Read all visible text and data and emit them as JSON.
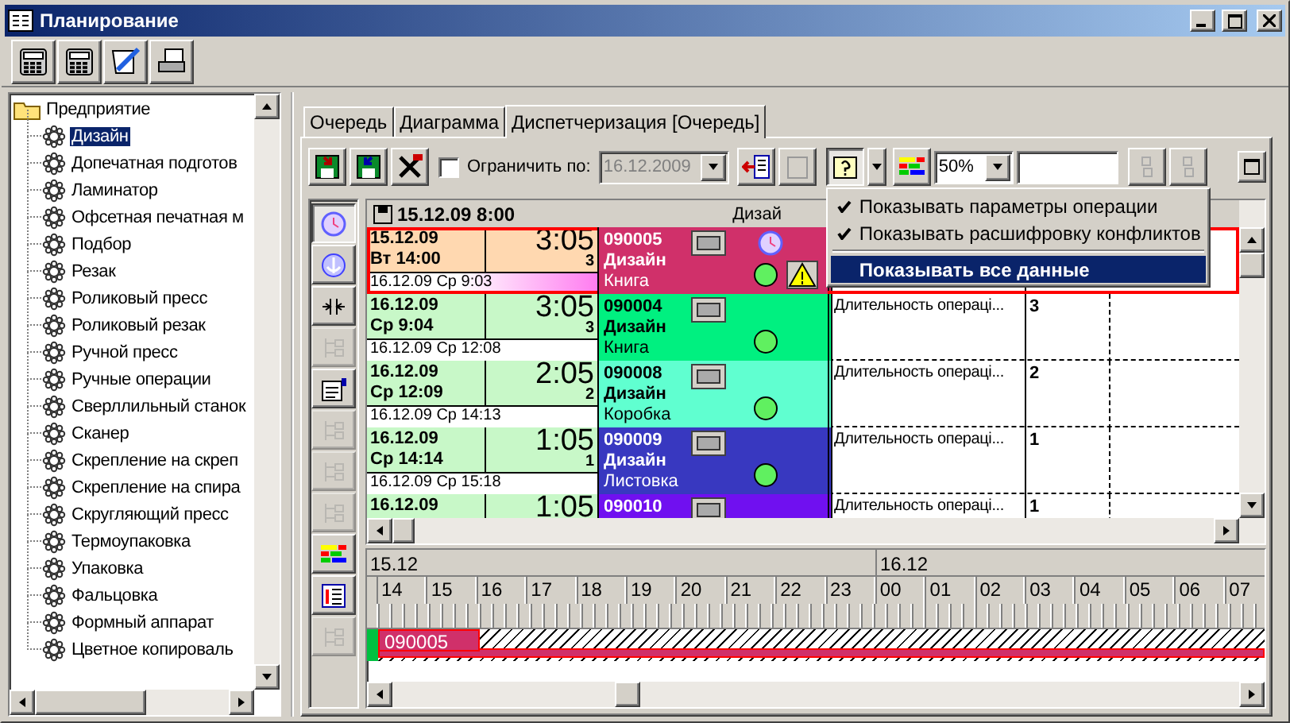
{
  "window": {
    "title": "Планирование"
  },
  "tree": {
    "label": "Предприятие",
    "children": [
      {
        "label": "Дизайн",
        "selected": true
      },
      {
        "label": "Допечатная подготов",
        "selected": false
      },
      {
        "label": "Ламинатор",
        "selected": false
      },
      {
        "label": "Офсетная печатная м",
        "selected": false
      },
      {
        "label": "Подбор",
        "selected": false
      },
      {
        "label": "Резак",
        "selected": false
      },
      {
        "label": "Роликовый пресс",
        "selected": false
      },
      {
        "label": "Роликовый резак",
        "selected": false
      },
      {
        "label": "Ручной пресс",
        "selected": false
      },
      {
        "label": "Ручные операции",
        "selected": false
      },
      {
        "label": "Сверллильный станок",
        "selected": false
      },
      {
        "label": "Сканер",
        "selected": false
      },
      {
        "label": "Скрепление на скреп",
        "selected": false
      },
      {
        "label": "Скрепление на спира",
        "selected": false
      },
      {
        "label": "Скругляющий пресс",
        "selected": false
      },
      {
        "label": "Термоупаковка",
        "selected": false
      },
      {
        "label": "Упаковка",
        "selected": false
      },
      {
        "label": "Фальцовка",
        "selected": false
      },
      {
        "label": "Формный аппарат",
        "selected": false
      },
      {
        "label": "Цветное копироваль",
        "selected": false
      }
    ]
  },
  "tabs": [
    {
      "label": "Очередь",
      "selected": false
    },
    {
      "label": "Диаграмма",
      "selected": false
    },
    {
      "label": "Диспетчеризация [Очередь]",
      "selected": true
    }
  ],
  "toolbar": {
    "limit_checkbox": {
      "label": "Ограничить по:",
      "checked": false
    },
    "limit_date": {
      "value": "16.12.2009",
      "disabled": true
    },
    "help_pressed": true,
    "zoom": {
      "value": "50%"
    }
  },
  "help_menu": {
    "open": true,
    "items": [
      {
        "kind": "check",
        "label": "Показывать параметры операции",
        "checked": true,
        "selected": false
      },
      {
        "kind": "check",
        "label": "Показывать расшифровку конфликтов",
        "checked": true,
        "selected": false
      },
      {
        "kind": "separator"
      },
      {
        "kind": "command",
        "label": "Показывать все данные",
        "selected": true
      }
    ]
  },
  "side_tools": [
    {
      "pressed": true,
      "disabled": false
    },
    {
      "pressed": false,
      "disabled": false
    },
    {
      "pressed": false,
      "disabled": false
    },
    {
      "pressed": false,
      "disabled": true
    },
    {
      "pressed": false,
      "disabled": false
    },
    {
      "pressed": false,
      "disabled": true
    },
    {
      "pressed": false,
      "disabled": true
    },
    {
      "pressed": false,
      "disabled": true
    },
    {
      "pressed": false,
      "disabled": false
    },
    {
      "pressed": false,
      "disabled": false
    },
    {
      "pressed": false,
      "disabled": true
    }
  ],
  "grid": {
    "header": {
      "start": "15.12.09 8:00",
      "column_2": "Дизай"
    },
    "rows": [
      {
        "start_date": "15.12.09",
        "start_time": "Вт 14:00",
        "duration": "3:05",
        "count": "3",
        "end": "16.12.09 Ср 9:03",
        "code": "090005",
        "operation": "Дизайн",
        "product": "Книга",
        "color": "#d0306a",
        "conflict": true,
        "clock": true
      },
      {
        "start_date": "16.12.09",
        "start_time": "Ср 9:04",
        "duration": "3:05",
        "count": "3",
        "end": "16.12.09 Ср 12:08",
        "code": "090004",
        "operation": "Дизайн",
        "product": "Книга",
        "color": "#00f080",
        "conflict": false,
        "clock": false,
        "parameter": "Длительность операці...",
        "value": "3"
      },
      {
        "start_date": "16.12.09",
        "start_time": "Ср 12:09",
        "duration": "2:05",
        "count": "2",
        "end": "16.12.09 Ср 14:13",
        "code": "090008",
        "operation": "Дизайн",
        "product": "Коробка",
        "color": "#60ffd0",
        "conflict": false,
        "clock": false,
        "parameter": "Длительность операці...",
        "value": "2"
      },
      {
        "start_date": "16.12.09",
        "start_time": "Ср 14:14",
        "duration": "1:05",
        "count": "1",
        "end": "16.12.09 Ср 15:18",
        "code": "090009",
        "operation": "Дизайн",
        "product": "Листовка",
        "color": "#3838c0",
        "conflict": false,
        "clock": false,
        "parameter": "Длительность операці...",
        "value": "1"
      },
      {
        "start_date": "16.12.09",
        "duration": "1:05",
        "code": "090010",
        "color": "#7010f0",
        "conflict": false,
        "clock": false,
        "parameter": "Длительность операці...",
        "value": "1"
      }
    ]
  },
  "timeline": {
    "days": [
      "15.12",
      "16.12"
    ],
    "hours": [
      "14",
      "15",
      "16",
      "17",
      "18",
      "19",
      "20",
      "21",
      "22",
      "23",
      "00",
      "01",
      "02",
      "03",
      "04",
      "05",
      "06",
      "07"
    ],
    "bars": [
      {
        "label": "090005",
        "color": "#d0306a"
      }
    ]
  }
}
